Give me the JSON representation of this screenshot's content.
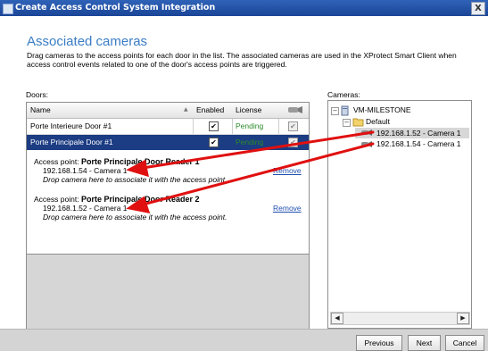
{
  "window": {
    "title": "Create Access Control System Integration",
    "close_label": "X"
  },
  "page": {
    "heading": "Associated cameras",
    "description": "Drag cameras to the access points for each door in the list. The associated cameras are used in the XProtect Smart Client when access control events related to one of the door's access points are triggered."
  },
  "doors": {
    "label": "Doors:",
    "columns": {
      "name": "Name",
      "enabled": "Enabled",
      "license": "License"
    },
    "rows": [
      {
        "name": "Porte Interieure Door #1",
        "enabled": true,
        "license": "Pending"
      },
      {
        "name": "Porte Principale Door #1",
        "enabled": true,
        "license": "Pending",
        "selected": true
      }
    ],
    "access_points": [
      {
        "prefix": "Access point:",
        "name": "Porte Principale Door Reader 1",
        "camera": "192.168.1.54 - Camera 1",
        "hint": "Drop camera here to associate it with the access point.",
        "remove": "Remove"
      },
      {
        "prefix": "Access point:",
        "name": "Porte Principale Door Reader 2",
        "camera": "192.168.1.52 - Camera 1",
        "hint": "Drop camera here to associate it with the access point.",
        "remove": "Remove"
      }
    ]
  },
  "cameras": {
    "label": "Cameras:",
    "server": "VM-MILESTONE",
    "group": "Default",
    "items": [
      "192.168.1.52 - Camera 1",
      "192.168.1.54 - Camera 1"
    ]
  },
  "buttons": {
    "previous": "Previous",
    "next": "Next",
    "cancel": "Cancel"
  },
  "colors": {
    "accent": "#3a7dc4",
    "selection": "#1c3c83",
    "pending": "#2a8a2a",
    "annotation_arrow": "#e01010"
  }
}
